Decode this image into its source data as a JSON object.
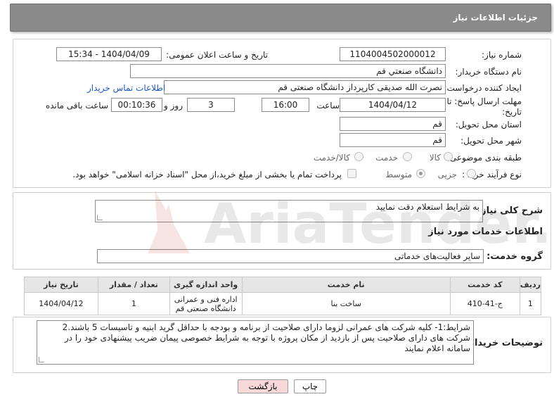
{
  "header": {
    "title": "جزئیات اطلاعات نیاز"
  },
  "form": {
    "need_number_label": "شماره نیاز:",
    "need_number": "1104004502000012",
    "announce_label": "تاریخ و ساعت اعلان عمومی:",
    "announce_value": "1404/04/09 - 15:34",
    "buyer_org_label": "نام دستگاه خریدار:",
    "buyer_org": "دانشگاه صنعتي قم",
    "creator_label": "ایجاد کننده درخواست:",
    "creator": "نصرت الله صدیقی کارپرداز دانشگاه صنعتی قم",
    "contact_link": "اطلاعات تماس خریدار",
    "deadline_label_1": "مهلت ارسال پاسخ: تا",
    "deadline_label_2": "تاریخ:",
    "deadline_date": "1404/04/12",
    "time_label": "ساعت",
    "deadline_time": "16:00",
    "days_value": "3",
    "days_label": "روز و",
    "remaining_time": "00:10:36",
    "remaining_label": "ساعت باقی مانده",
    "province_label": "استان محل تحویل:",
    "province": "قم",
    "city_label": "شهر محل تحویل:",
    "city": "قم",
    "category_label": "طبقه بندی موضوعی:",
    "category_options": [
      "کالا",
      "خدمت",
      "کالا/خدمت"
    ],
    "category_selected": "خدمت",
    "process_label": "نوع فرآیند خرید :",
    "process_options": [
      "جزیی",
      "متوسط"
    ],
    "process_selected": "جزیی",
    "payment_note": "پرداخت تمام یا بخشی از مبلغ خرید،از محل \"اسناد خزانه اسلامی\" خواهد بود."
  },
  "description": {
    "label": "شرح کلی نیاز:",
    "text": "به شرایط استعلام دقت نمایید"
  },
  "services": {
    "section_title": "اطلاعات خدمات مورد نیاز",
    "group_label": "گروه خدمت:",
    "group_value": "سایر فعالیت‌های خدماتی",
    "columns": [
      "ردیف",
      "کد خدمت",
      "نام خدمت",
      "واحد اندازه گیری",
      "تعداد / مقدار",
      "تاریخ نیاز"
    ],
    "rows": [
      [
        "1",
        "ج-41-410",
        "ساخت بنا",
        "اداره فنی و عمرانی دانشگاه صنعتی قم",
        "1",
        "1404/04/12"
      ]
    ]
  },
  "buyer_notes": {
    "label": "توضیحات خریدار:",
    "text": "شرایط:1- کلیه شرکت های عمرانی لزوما دارای صلاحیت از برنامه و بودجه با حداقل گرید ابنیه و تاسیسات 5 باشند.2 شرکت های دارای صلاحیت پس از بازدید از مکان پروژه با توجه به شرایط خصوصی پیمان ضریب پیشنهادی خود را در سامانه اعلام نمایند"
  },
  "buttons": {
    "print": "چاپ",
    "back": "بازگشت"
  },
  "watermark": {
    "text": "AriaTender.neT"
  },
  "colors": {
    "header_bg": "#8a8a8a",
    "link": "#1a56c8",
    "back_button_bg": "#f7d9d9"
  }
}
